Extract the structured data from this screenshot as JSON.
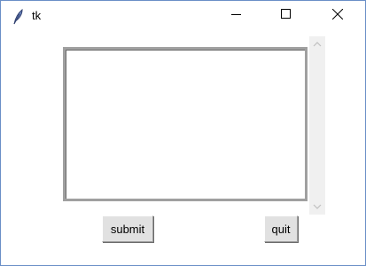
{
  "window": {
    "title": "tk",
    "icons": {
      "app": "feather-icon",
      "minimize": "minimize-icon",
      "maximize": "maximize-icon",
      "close": "close-icon",
      "scroll_up": "chevron-up-icon",
      "scroll_down": "chevron-down-icon"
    }
  },
  "text_area": {
    "value": ""
  },
  "buttons": {
    "submit_label": "submit",
    "quit_label": "quit"
  },
  "colors": {
    "window_border": "#6b8fc7",
    "button_face": "#e1e1e1",
    "scrollbar_track": "#f0f0f0"
  }
}
